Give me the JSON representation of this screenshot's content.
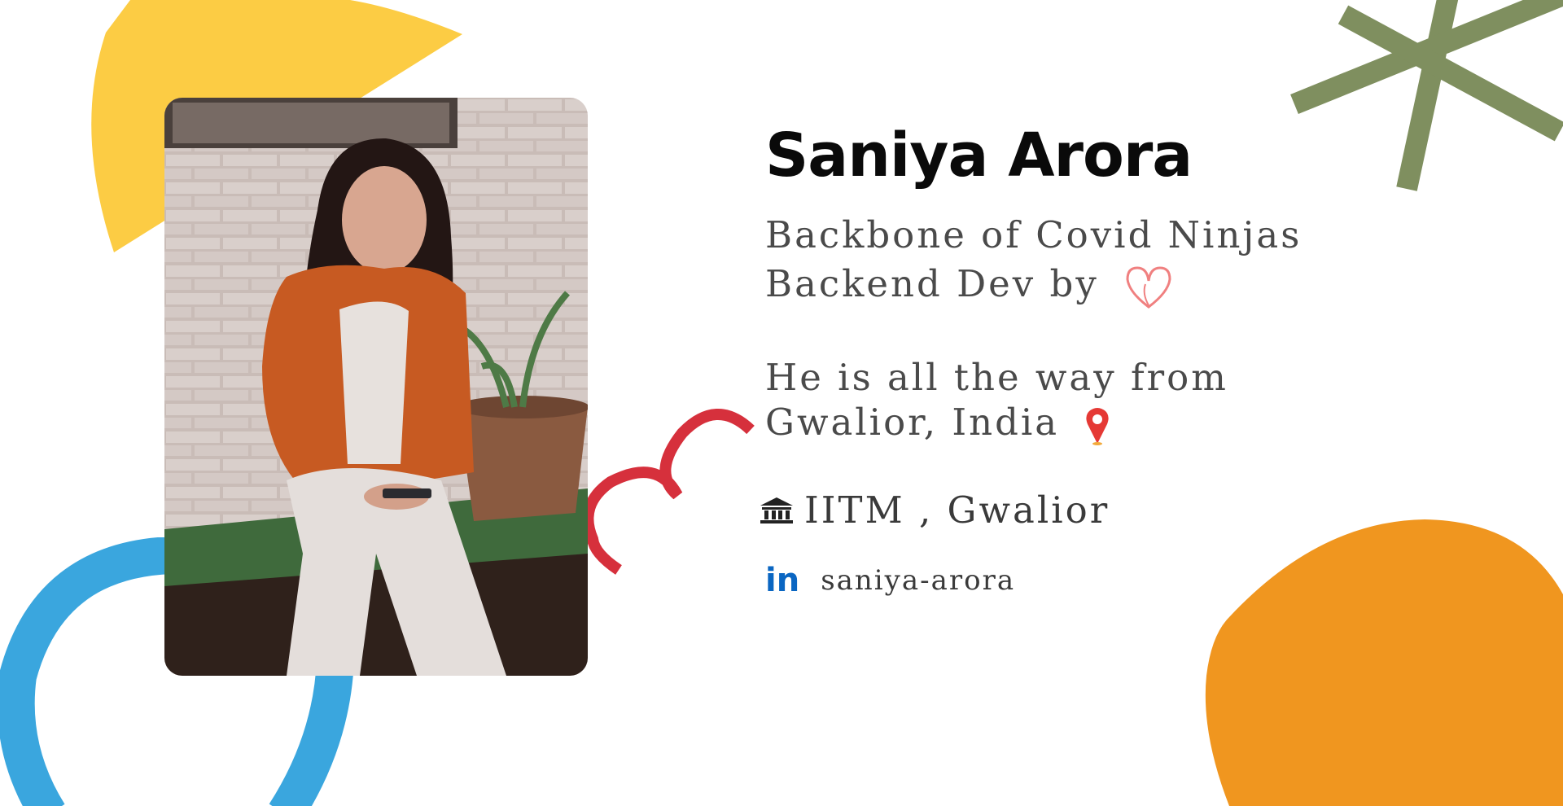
{
  "profile": {
    "name": "Saniya Arora",
    "role_line_1": "Backbone of Covid Ninjas",
    "role_line_2": "Backend Dev by",
    "origin_line_1": "He is all the way from",
    "origin_line_2": "Gwalior, India",
    "college": "IITM , Gwalior",
    "linkedin_handle": "saniya-arora"
  },
  "icons": {
    "heart": "heart-icon",
    "location": "location-pin-icon",
    "college": "building-icon",
    "linkedin": "linkedin-icon",
    "linkedin_glyph": "in"
  },
  "colors": {
    "yellow": "#fccc44",
    "green": "#7f8f5f",
    "blue": "#3aa6de",
    "red": "#d6303c",
    "orange": "#f0961f",
    "linkedin": "#0a66c2",
    "heart": "#f08080"
  }
}
